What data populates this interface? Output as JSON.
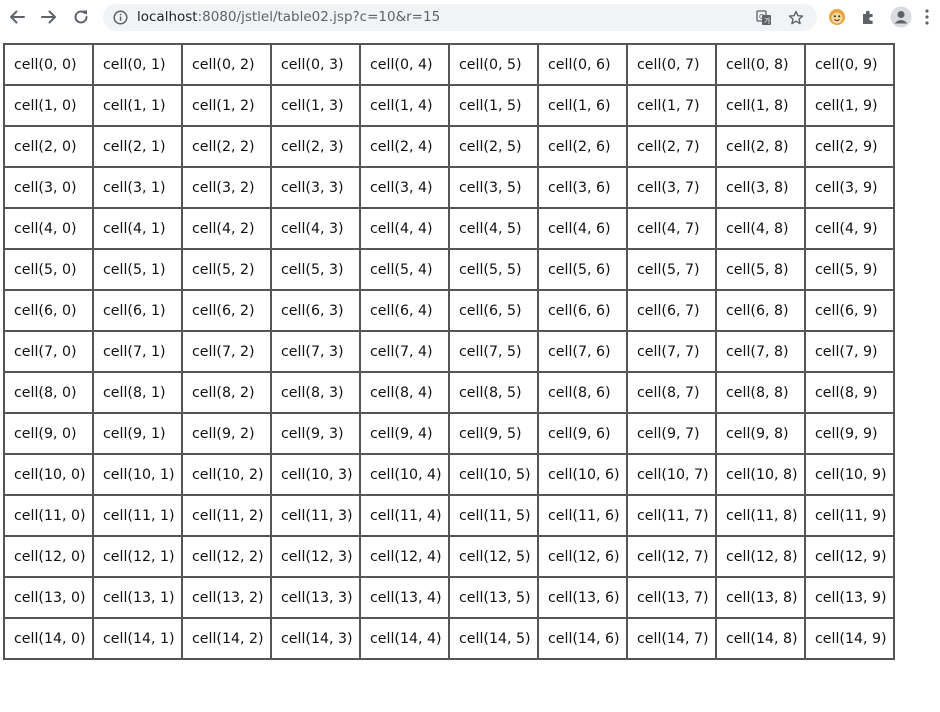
{
  "browser": {
    "url_host": "localhost",
    "url_rest": ":8080/jstlel/table02.jsp?c=10&r=15",
    "icons": {
      "back": "back-arrow-icon",
      "forward": "forward-arrow-icon",
      "reload": "reload-icon",
      "site_info": "info-icon",
      "translate": "translate-icon",
      "bookmark": "star-icon",
      "extension_1": "cookie-extension-icon",
      "extensions": "puzzle-icon",
      "profile": "profile-icon",
      "menu": "kebab-menu-icon"
    }
  },
  "table": {
    "rows": [
      [
        "cell(0, 0)",
        "cell(0, 1)",
        "cell(0, 2)",
        "cell(0, 3)",
        "cell(0, 4)",
        "cell(0, 5)",
        "cell(0, 6)",
        "cell(0, 7)",
        "cell(0, 8)",
        "cell(0, 9)"
      ],
      [
        "cell(1, 0)",
        "cell(1, 1)",
        "cell(1, 2)",
        "cell(1, 3)",
        "cell(1, 4)",
        "cell(1, 5)",
        "cell(1, 6)",
        "cell(1, 7)",
        "cell(1, 8)",
        "cell(1, 9)"
      ],
      [
        "cell(2, 0)",
        "cell(2, 1)",
        "cell(2, 2)",
        "cell(2, 3)",
        "cell(2, 4)",
        "cell(2, 5)",
        "cell(2, 6)",
        "cell(2, 7)",
        "cell(2, 8)",
        "cell(2, 9)"
      ],
      [
        "cell(3, 0)",
        "cell(3, 1)",
        "cell(3, 2)",
        "cell(3, 3)",
        "cell(3, 4)",
        "cell(3, 5)",
        "cell(3, 6)",
        "cell(3, 7)",
        "cell(3, 8)",
        "cell(3, 9)"
      ],
      [
        "cell(4, 0)",
        "cell(4, 1)",
        "cell(4, 2)",
        "cell(4, 3)",
        "cell(4, 4)",
        "cell(4, 5)",
        "cell(4, 6)",
        "cell(4, 7)",
        "cell(4, 8)",
        "cell(4, 9)"
      ],
      [
        "cell(5, 0)",
        "cell(5, 1)",
        "cell(5, 2)",
        "cell(5, 3)",
        "cell(5, 4)",
        "cell(5, 5)",
        "cell(5, 6)",
        "cell(5, 7)",
        "cell(5, 8)",
        "cell(5, 9)"
      ],
      [
        "cell(6, 0)",
        "cell(6, 1)",
        "cell(6, 2)",
        "cell(6, 3)",
        "cell(6, 4)",
        "cell(6, 5)",
        "cell(6, 6)",
        "cell(6, 7)",
        "cell(6, 8)",
        "cell(6, 9)"
      ],
      [
        "cell(7, 0)",
        "cell(7, 1)",
        "cell(7, 2)",
        "cell(7, 3)",
        "cell(7, 4)",
        "cell(7, 5)",
        "cell(7, 6)",
        "cell(7, 7)",
        "cell(7, 8)",
        "cell(7, 9)"
      ],
      [
        "cell(8, 0)",
        "cell(8, 1)",
        "cell(8, 2)",
        "cell(8, 3)",
        "cell(8, 4)",
        "cell(8, 5)",
        "cell(8, 6)",
        "cell(8, 7)",
        "cell(8, 8)",
        "cell(8, 9)"
      ],
      [
        "cell(9, 0)",
        "cell(9, 1)",
        "cell(9, 2)",
        "cell(9, 3)",
        "cell(9, 4)",
        "cell(9, 5)",
        "cell(9, 6)",
        "cell(9, 7)",
        "cell(9, 8)",
        "cell(9, 9)"
      ],
      [
        "cell(10, 0)",
        "cell(10, 1)",
        "cell(10, 2)",
        "cell(10, 3)",
        "cell(10, 4)",
        "cell(10, 5)",
        "cell(10, 6)",
        "cell(10, 7)",
        "cell(10, 8)",
        "cell(10, 9)"
      ],
      [
        "cell(11, 0)",
        "cell(11, 1)",
        "cell(11, 2)",
        "cell(11, 3)",
        "cell(11, 4)",
        "cell(11, 5)",
        "cell(11, 6)",
        "cell(11, 7)",
        "cell(11, 8)",
        "cell(11, 9)"
      ],
      [
        "cell(12, 0)",
        "cell(12, 1)",
        "cell(12, 2)",
        "cell(12, 3)",
        "cell(12, 4)",
        "cell(12, 5)",
        "cell(12, 6)",
        "cell(12, 7)",
        "cell(12, 8)",
        "cell(12, 9)"
      ],
      [
        "cell(13, 0)",
        "cell(13, 1)",
        "cell(13, 2)",
        "cell(13, 3)",
        "cell(13, 4)",
        "cell(13, 5)",
        "cell(13, 6)",
        "cell(13, 7)",
        "cell(13, 8)",
        "cell(13, 9)"
      ],
      [
        "cell(14, 0)",
        "cell(14, 1)",
        "cell(14, 2)",
        "cell(14, 3)",
        "cell(14, 4)",
        "cell(14, 5)",
        "cell(14, 6)",
        "cell(14, 7)",
        "cell(14, 8)",
        "cell(14, 9)"
      ]
    ]
  }
}
